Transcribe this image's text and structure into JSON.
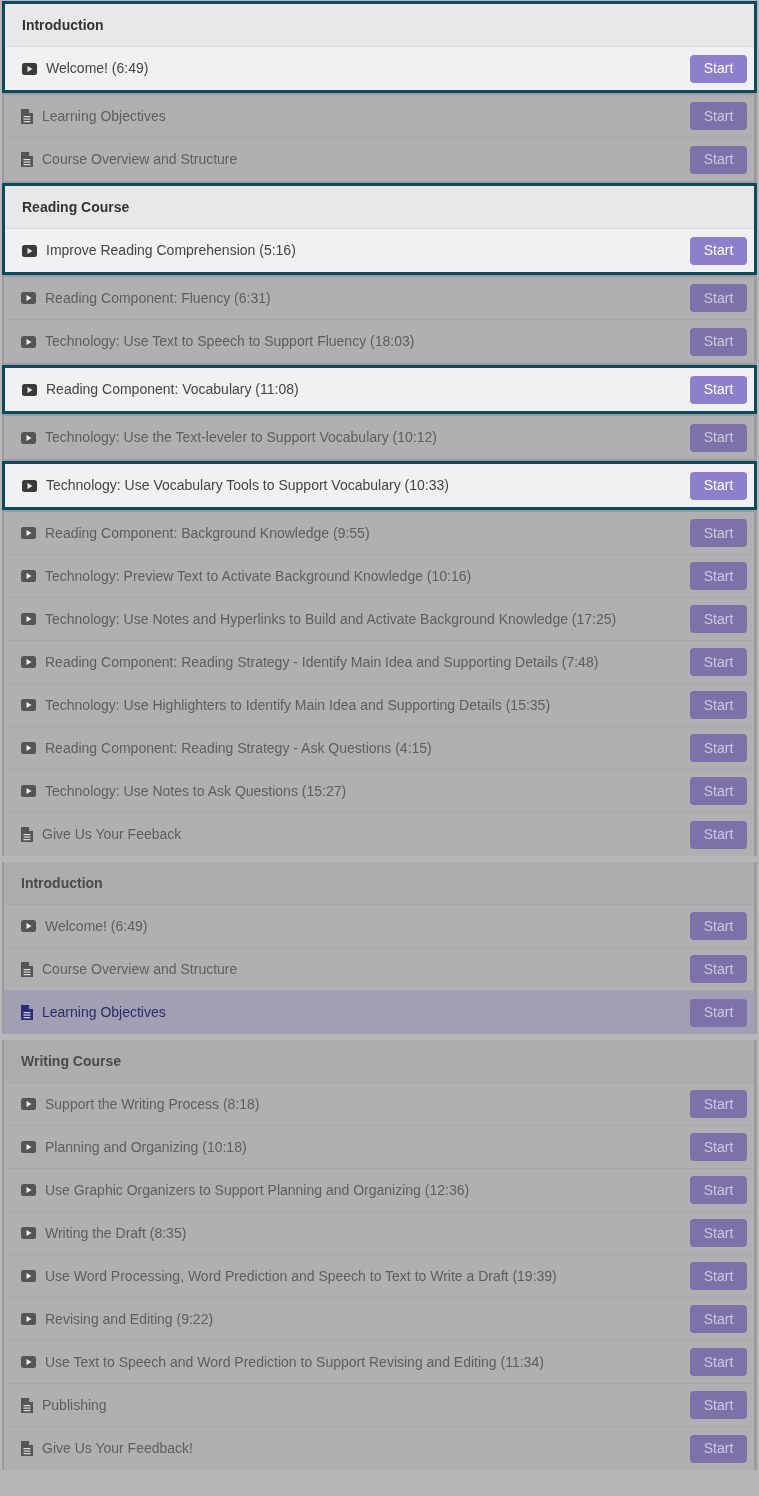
{
  "sections": [
    {
      "segments": [
        {
          "highlighted": true,
          "rows": [
            {
              "kind": "heading",
              "title": "Introduction"
            },
            {
              "kind": "video",
              "title": "Welcome! (6:49)",
              "button": "Start",
              "selected": false
            }
          ]
        },
        {
          "highlighted": false,
          "rows": [
            {
              "kind": "document",
              "title": "Learning Objectives",
              "button": "Start",
              "selected": false
            },
            {
              "kind": "document",
              "title": "Course Overview and Structure",
              "button": "Start",
              "selected": false
            }
          ]
        },
        {
          "highlighted": true,
          "rows": [
            {
              "kind": "heading",
              "title": "Reading Course"
            },
            {
              "kind": "video",
              "title": "Improve Reading Comprehension (5:16)",
              "button": "Start",
              "selected": false
            }
          ]
        },
        {
          "highlighted": false,
          "rows": [
            {
              "kind": "video",
              "title": "Reading Component: Fluency (6:31)",
              "button": "Start",
              "selected": false
            },
            {
              "kind": "video",
              "title": "Technology: Use Text to Speech to Support Fluency (18:03)",
              "button": "Start",
              "selected": false
            }
          ]
        },
        {
          "highlighted": true,
          "rows": [
            {
              "kind": "video",
              "title": "Reading Component: Vocabulary (11:08)",
              "button": "Start",
              "selected": false
            }
          ]
        },
        {
          "highlighted": false,
          "rows": [
            {
              "kind": "video",
              "title": "Technology: Use the Text-leveler to Support Vocabulary (10:12)",
              "button": "Start",
              "selected": false
            }
          ]
        },
        {
          "highlighted": true,
          "rows": [
            {
              "kind": "video",
              "title": "Technology: Use Vocabulary Tools to Support Vocabulary (10:33)",
              "button": "Start",
              "selected": false
            }
          ]
        },
        {
          "highlighted": false,
          "rows": [
            {
              "kind": "video",
              "title": "Reading Component: Background Knowledge (9:55)",
              "button": "Start",
              "selected": false
            },
            {
              "kind": "video",
              "title": "Technology: Preview Text to Activate Background Knowledge (10:16)",
              "button": "Start",
              "selected": false
            },
            {
              "kind": "video",
              "title": "Technology: Use Notes and Hyperlinks to Build and Activate Background Knowledge (17:25)",
              "button": "Start",
              "selected": false
            },
            {
              "kind": "video",
              "title": "Reading Component: Reading Strategy - Identify Main Idea and Supporting Details (7:48)",
              "button": "Start",
              "selected": false
            },
            {
              "kind": "video",
              "title": "Technology: Use Highlighters to Identify Main Idea and Supporting Details (15:35)",
              "button": "Start",
              "selected": false
            },
            {
              "kind": "video",
              "title": "Reading Component: Reading Strategy - Ask Questions (4:15)",
              "button": "Start",
              "selected": false
            },
            {
              "kind": "video",
              "title": "Technology: Use Notes to Ask Questions (15:27)",
              "button": "Start",
              "selected": false
            },
            {
              "kind": "document",
              "title": "Give Us Your Feeback",
              "button": "Start",
              "selected": false
            }
          ]
        }
      ]
    },
    {
      "segments": [
        {
          "highlighted": false,
          "rows": [
            {
              "kind": "heading",
              "title": "Introduction"
            },
            {
              "kind": "video",
              "title": "Welcome! (6:49)",
              "button": "Start",
              "selected": false
            },
            {
              "kind": "document",
              "title": "Course Overview and Structure",
              "button": "Start",
              "selected": false
            },
            {
              "kind": "document",
              "title": "Learning Objectives",
              "button": "Start",
              "selected": true
            }
          ]
        }
      ]
    },
    {
      "segments": [
        {
          "highlighted": false,
          "rows": [
            {
              "kind": "heading",
              "title": "Writing Course"
            },
            {
              "kind": "video",
              "title": "Support the Writing Process (8:18)",
              "button": "Start",
              "selected": false
            },
            {
              "kind": "video",
              "title": "Planning and Organizing (10:18)",
              "button": "Start",
              "selected": false
            },
            {
              "kind": "video",
              "title": "Use Graphic Organizers to Support Planning and Organizing (12:36)",
              "button": "Start",
              "selected": false
            },
            {
              "kind": "video",
              "title": "Writing the Draft (8:35)",
              "button": "Start",
              "selected": false
            },
            {
              "kind": "video",
              "title": "Use Word Processing, Word Prediction and Speech to Text to Write a Draft (19:39)",
              "button": "Start",
              "selected": false
            },
            {
              "kind": "video",
              "title": "Revising and Editing (9:22)",
              "button": "Start",
              "selected": false
            },
            {
              "kind": "video",
              "title": "Use Text to Speech and Word Prediction to Support Revising and Editing (11:34)",
              "button": "Start",
              "selected": false
            },
            {
              "kind": "document",
              "title": "Publishing",
              "button": "Start",
              "selected": false
            },
            {
              "kind": "document",
              "title": "Give Us Your Feedback!",
              "button": "Start",
              "selected": false
            }
          ]
        }
      ]
    }
  ]
}
